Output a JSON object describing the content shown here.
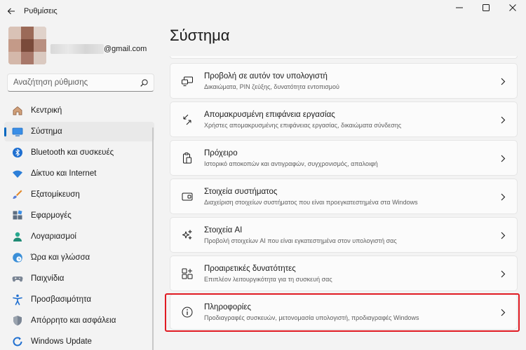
{
  "window": {
    "title": "Ρυθμίσεις"
  },
  "user": {
    "email_suffix": "@gmail.com"
  },
  "search": {
    "placeholder": "Αναζήτηση ρύθμισης"
  },
  "sidebar": {
    "items": [
      {
        "label": "Κεντρική",
        "icon": "home-icon",
        "active": false
      },
      {
        "label": "Σύστημα",
        "icon": "monitor-icon",
        "active": true
      },
      {
        "label": "Bluetooth και συσκευές",
        "icon": "bluetooth-icon",
        "active": false
      },
      {
        "label": "Δίκτυο και Internet",
        "icon": "wifi-icon",
        "active": false
      },
      {
        "label": "Εξατομίκευση",
        "icon": "brush-icon",
        "active": false
      },
      {
        "label": "Εφαρμογές",
        "icon": "apps-icon",
        "active": false
      },
      {
        "label": "Λογαριασμοί",
        "icon": "person-icon",
        "active": false
      },
      {
        "label": "Ώρα και γλώσσα",
        "icon": "clock-globe-icon",
        "active": false
      },
      {
        "label": "Παιχνίδια",
        "icon": "gamepad-icon",
        "active": false
      },
      {
        "label": "Προσβασιμότητα",
        "icon": "accessibility-icon",
        "active": false
      },
      {
        "label": "Απόρρητο και ασφάλεια",
        "icon": "shield-icon",
        "active": false
      },
      {
        "label": "Windows Update",
        "icon": "update-icon",
        "active": false
      }
    ]
  },
  "main": {
    "title": "Σύστημα",
    "cards": [
      {
        "title": "Προβολή σε αυτόν τον υπολογιστή",
        "desc": "Δικαιώματα, PIN ζεύξης, δυνατότητα εντοπισμού",
        "icon": "project-to-pc-icon"
      },
      {
        "title": "Απομακρυσμένη επιφάνεια εργασίας",
        "desc": "Χρήστες απομακρυσμένης επιφάνειας εργασίας, δικαιώματα σύνδεσης",
        "icon": "remote-desktop-icon"
      },
      {
        "title": "Πρόχειρο",
        "desc": "Ιστορικό αποκοπών και αντιγραφών, συγχρονισμός, απαλοιφή",
        "icon": "clipboard-icon"
      },
      {
        "title": "Στοιχεία συστήματος",
        "desc": "Διαχείριση στοιχείων συστήματος που είναι προεγκατεστημένα στα Windows",
        "icon": "system-components-icon"
      },
      {
        "title": "Στοιχεία AI",
        "desc": "Προβολή στοιχείων AI που είναι εγκατεστημένα στον υπολογιστή σας",
        "icon": "sparkle-icon"
      },
      {
        "title": "Προαιρετικές δυνατότητες",
        "desc": "Επιπλέον λειτουργικότητα για τη συσκευή σας",
        "icon": "optional-features-icon"
      },
      {
        "title": "Πληροφορίες",
        "desc": "Προδιαγραφές συσκευών, μετονομασία υπολογιστή, προδιαγραφές Windows",
        "icon": "info-icon"
      }
    ]
  },
  "colors": {
    "accent": "#0067c0",
    "highlight": "#e01a22",
    "background": "#f3f3f3",
    "card": "#fbfbfb"
  }
}
